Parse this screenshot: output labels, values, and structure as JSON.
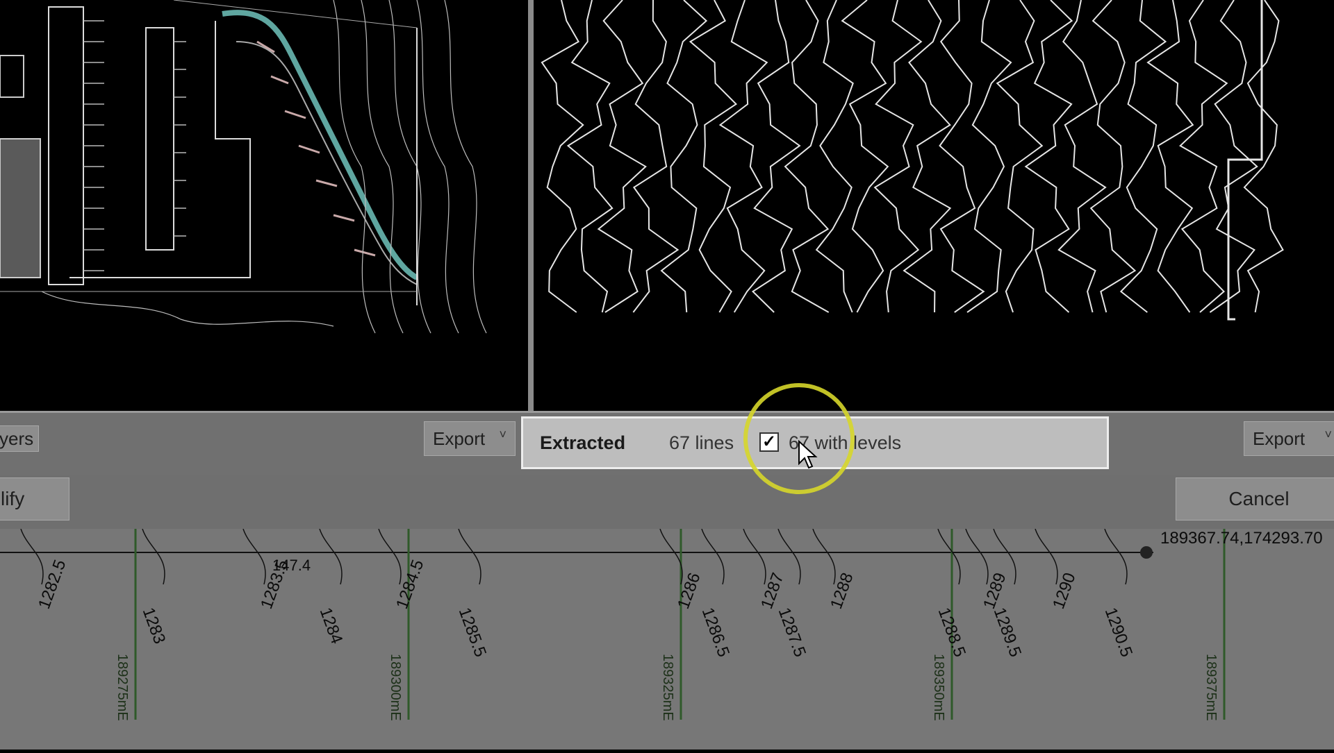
{
  "toolbar": {
    "layers_label": "yers",
    "export_left_label": "Export",
    "export_right_label": "Export",
    "chevron_glyph": "˅"
  },
  "row2": {
    "modify_label": "lify",
    "cancel_label": "Cancel"
  },
  "status": {
    "title": "Extracted",
    "lines_count": "67 lines",
    "checkbox_checked": true,
    "levels_text": "67 with levels"
  },
  "profile": {
    "coordinate": "189367.74,174293.70",
    "chainage": "147.4",
    "contour_labels": [
      "1282.5",
      "1283",
      "1283.5",
      "1284",
      "1284.5",
      "1285.5",
      "1286",
      "1286.5",
      "1287",
      "1287.5",
      "1288",
      "1288.5",
      "1289",
      "1289.5",
      "1290",
      "1290.5"
    ],
    "grid_labels": [
      "189275mE",
      "189300mE",
      "189325mE",
      "189350mE",
      "189375mE"
    ]
  },
  "colors": {
    "highlight_ring": "#d6d62a",
    "grid_line": "#2f5a2a",
    "drawing_line": "#e6e6e6",
    "wall_teal": "#5fa6a0"
  }
}
